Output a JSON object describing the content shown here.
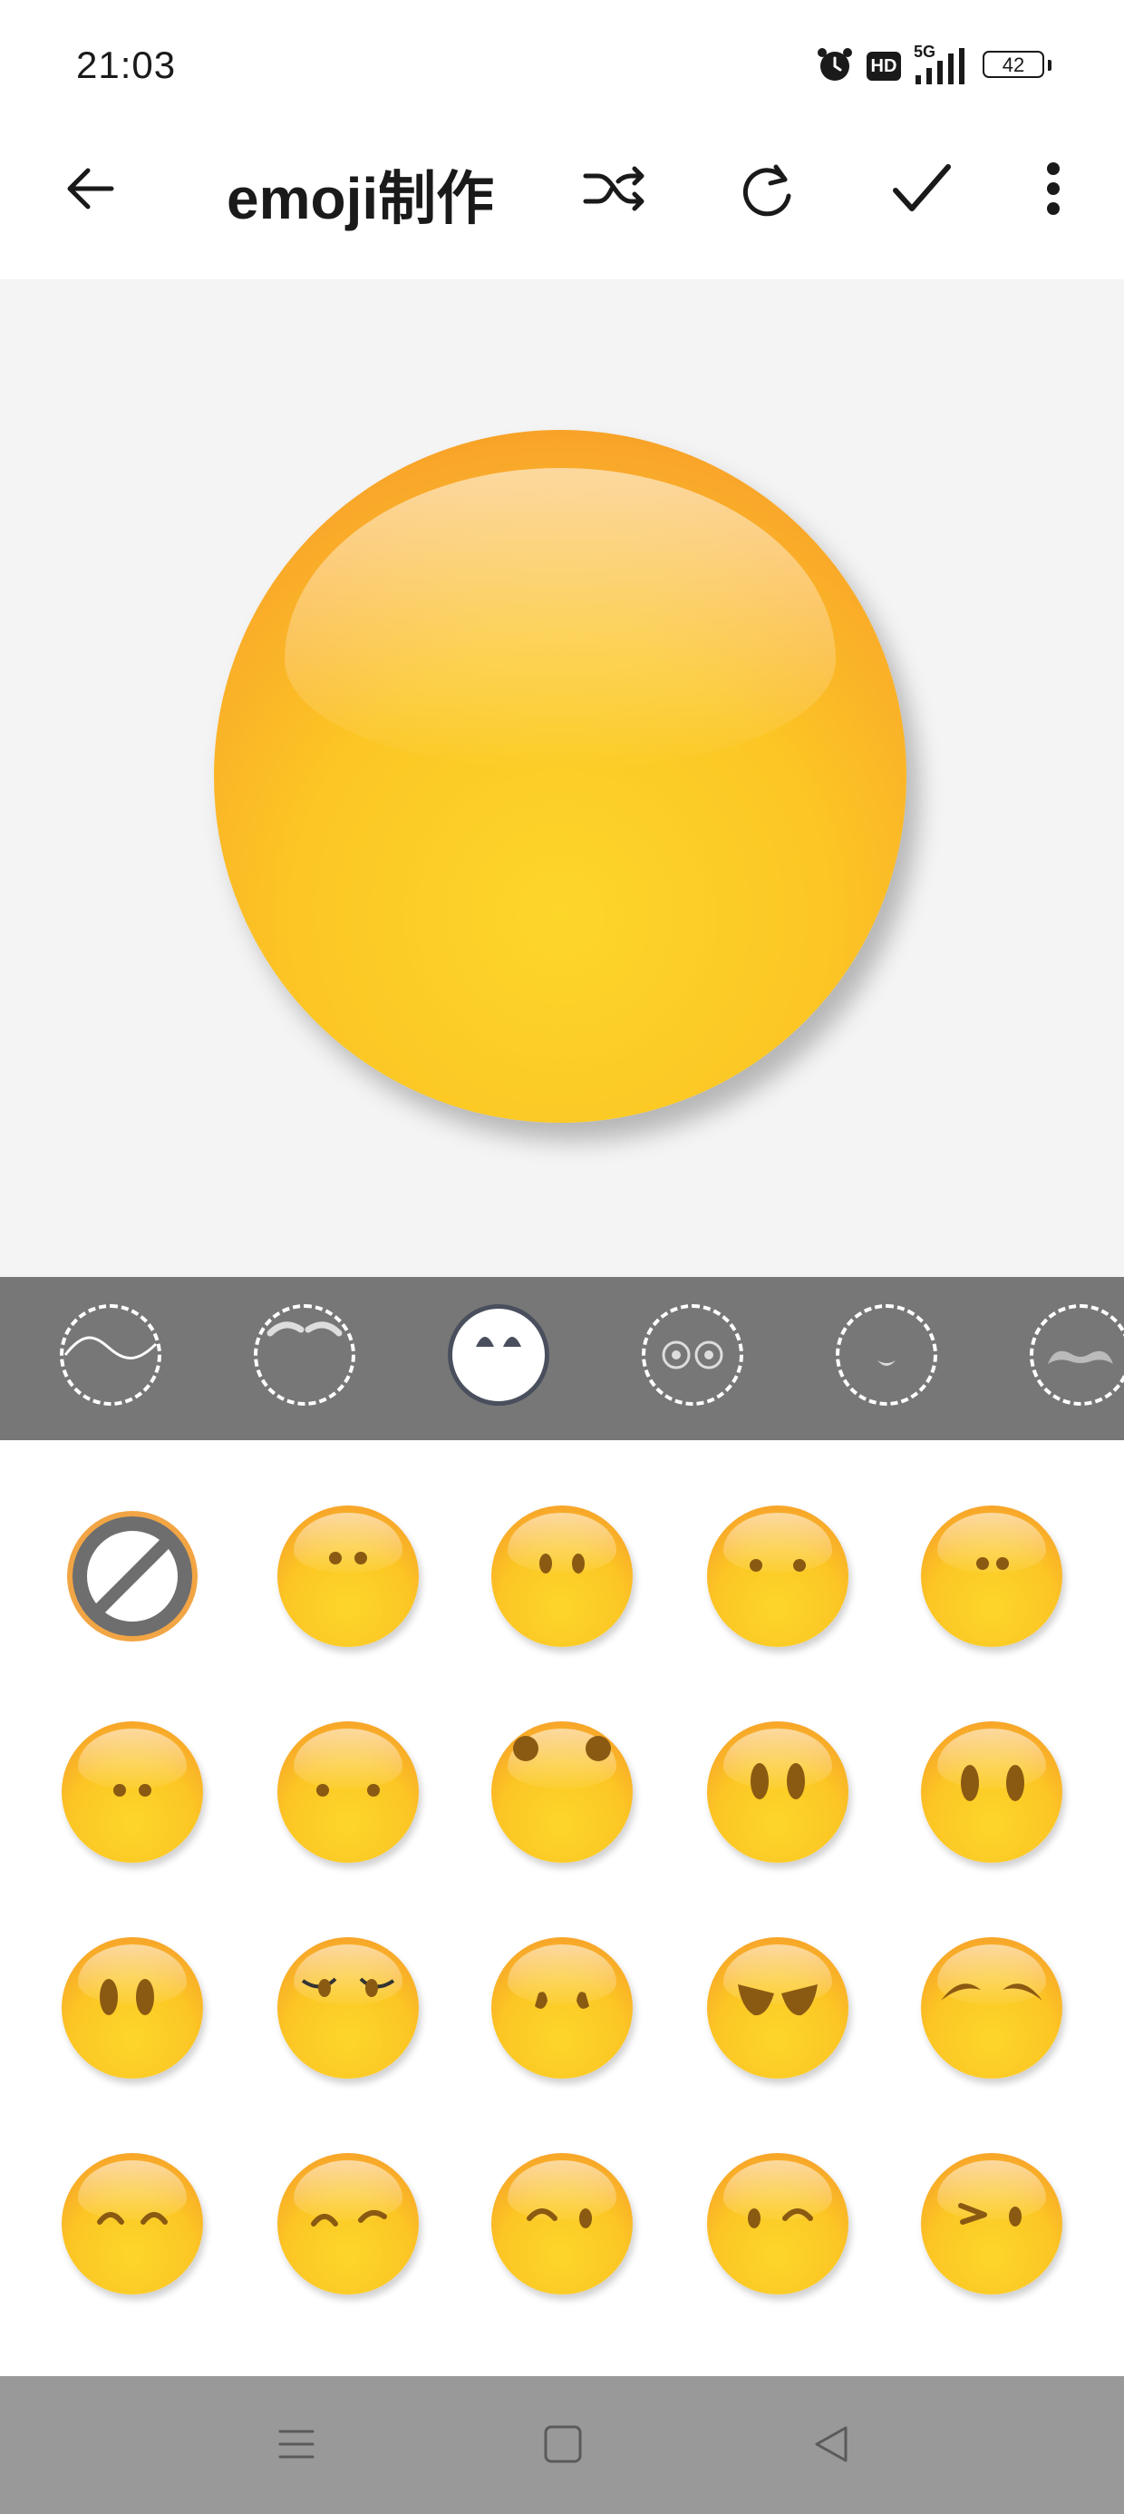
{
  "status_bar": {
    "time": "21:03",
    "icons": [
      "alarm-icon",
      "hd-icon",
      "5g-signal-icon",
      "battery-icon"
    ],
    "network": "5G",
    "hd_label": "HD",
    "battery": "42"
  },
  "app_bar": {
    "title": "emoji制作",
    "actions": [
      "back-arrow-icon",
      "shuffle-icon",
      "refresh-icon",
      "check-icon",
      "more-vertical-icon"
    ]
  },
  "categories": [
    {
      "name": "face-shape",
      "icon": "face-outline-icon",
      "selected": false
    },
    {
      "name": "eyebrows",
      "icon": "eyebrows-icon",
      "selected": false
    },
    {
      "name": "eyes",
      "icon": "eyes-icon",
      "selected": true
    },
    {
      "name": "glasses",
      "icon": "glasses-icon",
      "selected": false
    },
    {
      "name": "mouth",
      "icon": "mouth-icon",
      "selected": false
    },
    {
      "name": "mustache",
      "icon": "mustache-icon",
      "selected": false
    }
  ],
  "eye_options": [
    {
      "style": "none"
    },
    {
      "style": "small-dots"
    },
    {
      "style": "ovals"
    },
    {
      "style": "wide-dots"
    },
    {
      "style": "small-dots-high"
    },
    {
      "style": "small-dots-low"
    },
    {
      "style": "wide-dots-low"
    },
    {
      "style": "big-dots-top"
    },
    {
      "style": "tall-ovals"
    },
    {
      "style": "tall-ovals-wide"
    },
    {
      "style": "tall-ovals-left"
    },
    {
      "style": "lashes"
    },
    {
      "style": "angry-drops"
    },
    {
      "style": "angry-brows"
    },
    {
      "style": "happy-arcs"
    },
    {
      "style": "sleepy-arcs"
    },
    {
      "style": "sleepy-arcs-raised"
    },
    {
      "style": "wink-left"
    },
    {
      "style": "wink-right"
    },
    {
      "style": "squint-wink"
    }
  ],
  "colors": {
    "accent": "#4a4f5e",
    "category_bar": "#777777",
    "canvas_bg": "#f4f4f4",
    "face_yellow": "#fcc624",
    "face_orange": "#f58a1f",
    "feature_brown": "#8a5a12",
    "nav_bar": "#999999"
  },
  "nav_bar": {
    "buttons": [
      "menu-icon",
      "home-icon",
      "back-icon"
    ]
  }
}
